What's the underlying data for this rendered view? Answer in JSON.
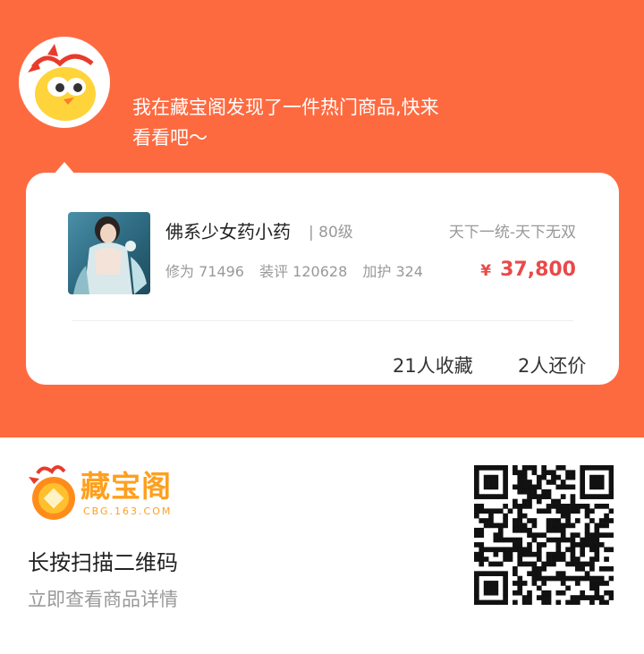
{
  "share": {
    "message_line1": "我在藏宝阁发现了一件热门商品,快来",
    "message_line2": "看看吧～"
  },
  "item": {
    "name": "佛系少女药小药",
    "level": "| 80级",
    "server": "天下一统-天下无双",
    "stats": [
      "修为 71496",
      "装评 120628",
      "加护 324"
    ],
    "currency": "¥",
    "price": "37,800",
    "collects": "21人收藏",
    "bargains": "2人还价"
  },
  "brand": {
    "logo_cn": "藏宝阁",
    "logo_en": "CBG.163.COM"
  },
  "scan": {
    "title": "长按扫描二维码",
    "subtitle": "立即查看商品详情"
  },
  "colors": {
    "brand_orange": "#fe6a40",
    "price_red": "#e84a4a",
    "logo_yellow": "#ff9f1c"
  },
  "icons": {
    "avatar": "chick-mascot-icon",
    "thumb": "character-portrait",
    "qr": "qr-code"
  }
}
